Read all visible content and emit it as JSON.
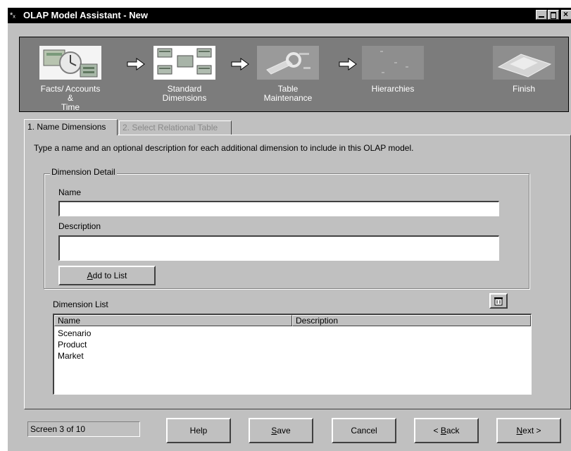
{
  "window": {
    "title": "OLAP Model Assistant - New",
    "app_icon": "olap-assistant-icon",
    "controls": [
      "minimize-icon",
      "maximize-icon",
      "close-icon"
    ]
  },
  "wizard_steps": [
    {
      "label_line1": "Facts/ Accounts &",
      "label_line2": "Time",
      "icon": "facts-time-clock-icon",
      "state": "completed"
    },
    {
      "label_line1": "Standard",
      "label_line2": "Dimensions",
      "icon": "standard-dimensions-icon",
      "state": "current"
    },
    {
      "label_line1": "Table",
      "label_line2": "Maintenance",
      "icon": "table-maintenance-wrench-icon",
      "state": "upcoming"
    },
    {
      "label_line1": "Hierarchies",
      "label_line2": "",
      "icon": "hierarchies-icon",
      "state": "upcoming"
    },
    {
      "label_line1": "Finish",
      "label_line2": "",
      "icon": "finish-icon",
      "state": "upcoming"
    }
  ],
  "tabs": [
    {
      "label": "1. Name Dimensions",
      "active": true
    },
    {
      "label": "2. Select Relational Table",
      "active": false,
      "disabled": true
    }
  ],
  "instructions": "Type a name and an optional description for each additional dimension to include in this OLAP model.",
  "dimension_detail": {
    "group_label": "Dimension Detail",
    "name_label": "Name",
    "name_value": "",
    "description_label": "Description",
    "description_value": "",
    "add_button": {
      "mnemonic": "A",
      "rest": "dd to List"
    }
  },
  "dimension_list": {
    "label": "Dimension List",
    "delete_icon": "remove-item-icon",
    "columns": [
      "Name",
      "Description"
    ],
    "rows": [
      {
        "name": "Scenario",
        "description": ""
      },
      {
        "name": "Product",
        "description": ""
      },
      {
        "name": "Market",
        "description": ""
      }
    ]
  },
  "footer": {
    "screen_counter": "Screen 3 of 10",
    "buttons": {
      "help": {
        "label": "Help"
      },
      "save": {
        "mnemonic": "S",
        "rest": "ave"
      },
      "cancel": {
        "label": "Cancel"
      },
      "back": {
        "prefix": "< ",
        "mnemonic": "B",
        "rest": "ack"
      },
      "next": {
        "mnemonic": "N",
        "rest": "ext >"
      }
    }
  },
  "colors": {
    "titlebar_bg": "#000000",
    "window_face": "#c0c0c0",
    "banner_bg": "#7c7c7c",
    "disabled_text": "#8a8a8a"
  }
}
